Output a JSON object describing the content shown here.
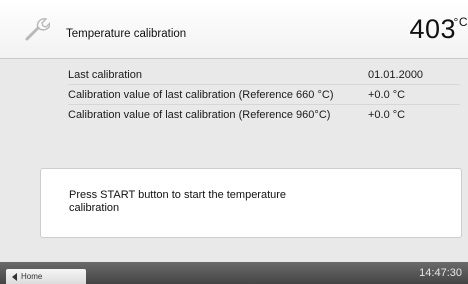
{
  "header": {
    "icon": "wrench-icon",
    "title": "Temperature calibration",
    "temperature": "403",
    "temperature_unit": "°C"
  },
  "calibration_rows": [
    {
      "label": "Last calibration",
      "value": "01.01.2000"
    },
    {
      "label": "Calibration value of last calibration (Reference 660 °C)",
      "value": "+0.0 °C"
    },
    {
      "label": "Calibration value of last calibration (Reference 960°C)",
      "value": "+0.0 °C"
    }
  ],
  "message": "Press START button to start the temperature calibration",
  "footer": {
    "home_label": "Home",
    "home_icon": "arrow-left-icon",
    "time": "14:47:30"
  }
}
